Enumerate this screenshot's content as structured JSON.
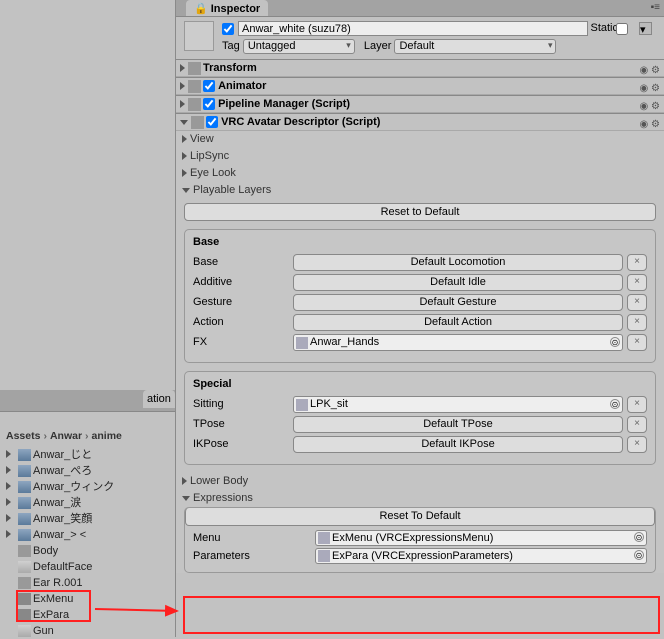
{
  "inspector_tab": "Inspector",
  "gameobject": {
    "name": "Anwar_white (suzu78)",
    "active": true,
    "static_label": "Static",
    "tag_label": "Tag",
    "tag": "Untagged",
    "layer_label": "Layer",
    "layer": "Default"
  },
  "components": {
    "transform": "Transform",
    "animator": "Animator",
    "pipeline": "Pipeline Manager (Script)",
    "avatar": "VRC Avatar Descriptor (Script)"
  },
  "avatar_sections": {
    "view": "View",
    "lipsync": "LipSync",
    "eyelook": "Eye Look",
    "playable": "Playable Layers"
  },
  "playable": {
    "reset_btn": "Reset to Default",
    "base_title": "Base",
    "rows": {
      "base": {
        "label": "Base",
        "btn": "Default Locomotion"
      },
      "additive": {
        "label": "Additive",
        "btn": "Default Idle"
      },
      "gesture": {
        "label": "Gesture",
        "btn": "Default Gesture"
      },
      "action": {
        "label": "Action",
        "btn": "Default Action"
      },
      "fx": {
        "label": "FX",
        "value": "Anwar_Hands"
      }
    },
    "special_title": "Special",
    "special": {
      "sitting": {
        "label": "Sitting",
        "value": "LPK_sit"
      },
      "tpose": {
        "label": "TPose",
        "btn": "Default TPose"
      },
      "ikpose": {
        "label": "IKPose",
        "btn": "Default IKPose"
      }
    }
  },
  "lowerbody": "Lower Body",
  "expressions": {
    "title": "Expressions",
    "reset_btn": "Reset To Default",
    "menu_label": "Menu",
    "menu_value": "ExMenu (VRCExpressionsMenu)",
    "params_label": "Parameters",
    "params_value": "ExPara (VRCExpressionParameters)"
  },
  "breadcrumb": [
    "Assets",
    "Anwar",
    "anime"
  ],
  "left_tab": "ation",
  "assets": [
    {
      "name": "Anwar_じと",
      "icon": "anim",
      "fold": true
    },
    {
      "name": "Anwar_ぺろ",
      "icon": "anim",
      "fold": true
    },
    {
      "name": "Anwar_ウィンク",
      "icon": "anim",
      "fold": true
    },
    {
      "name": "Anwar_涙",
      "icon": "anim",
      "fold": true
    },
    {
      "name": "Anwar_笑顔",
      "icon": "anim",
      "fold": true
    },
    {
      "name": "Anwar_> <",
      "icon": "anim",
      "fold": true
    },
    {
      "name": "Body",
      "icon": "mesh",
      "fold": false
    },
    {
      "name": "DefaultFace",
      "icon": "ctrl",
      "fold": false
    },
    {
      "name": "Ear R.001",
      "icon": "mesh",
      "fold": false
    },
    {
      "name": "ExMenu",
      "icon": "menu",
      "fold": false
    },
    {
      "name": "ExPara",
      "icon": "menu",
      "fold": false
    },
    {
      "name": "Gun",
      "icon": "ctrl",
      "fold": false
    }
  ]
}
